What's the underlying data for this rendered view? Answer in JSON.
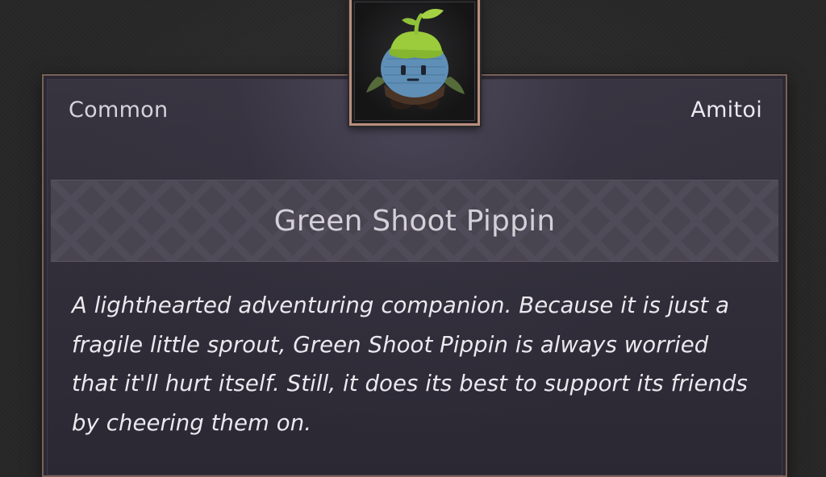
{
  "item": {
    "rarity": "Common",
    "category": "Amitoi",
    "name": "Green Shoot Pippin",
    "description": "A lighthearted adventuring companion. Because it is just a fragile little sprout, Green Shoot Pippin is always worried that it'll hurt itself. Still, it does its best to support its friends by cheering them on.",
    "portrait_icon": "green-shoot-pippin-icon"
  },
  "colors": {
    "frame_border": "#7a6256",
    "portrait_border": "#b98f7d",
    "panel_background": "#2c2935",
    "banner_background": "#4a4552",
    "text_primary": "#ebe9ee"
  }
}
